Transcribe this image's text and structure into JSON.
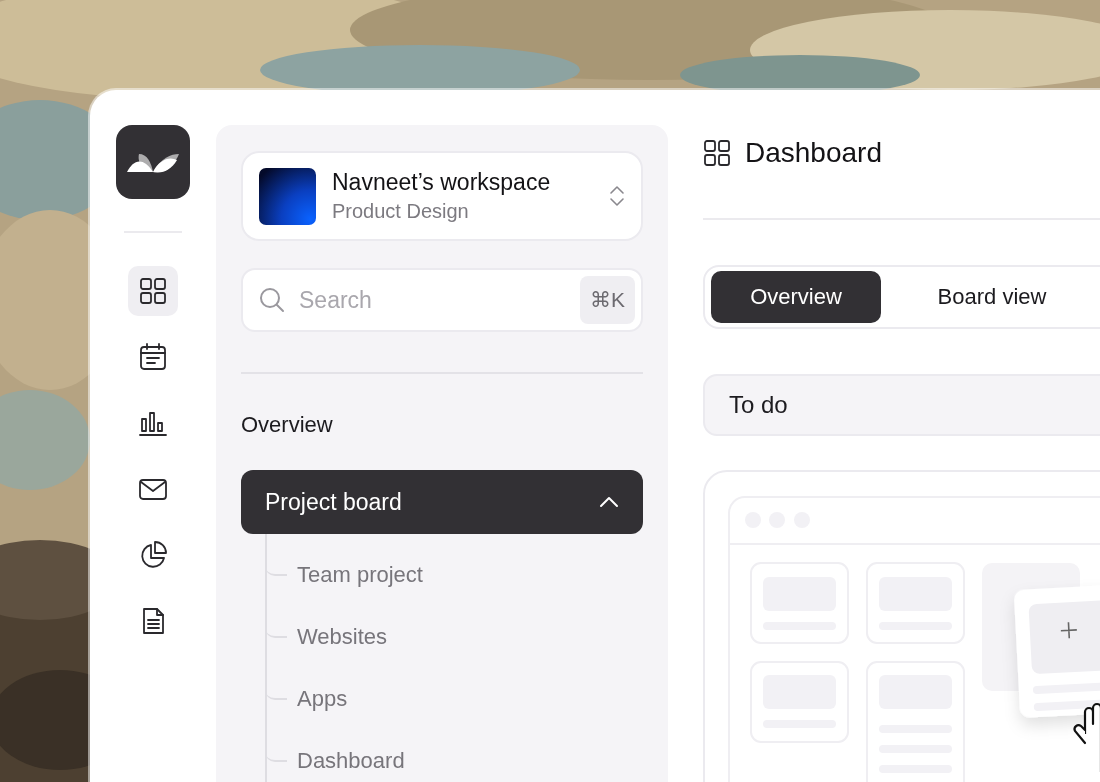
{
  "nav_rail": {
    "items": [
      {
        "kind": "grid",
        "selected": true
      },
      {
        "kind": "calendar",
        "selected": false
      },
      {
        "kind": "chart",
        "selected": false
      },
      {
        "kind": "mail",
        "selected": false
      },
      {
        "kind": "pie",
        "selected": false
      },
      {
        "kind": "document",
        "selected": false
      }
    ]
  },
  "workspace": {
    "name": "Navneet’s workspace",
    "team": "Product Design"
  },
  "search": {
    "placeholder": "Search",
    "shortcut": "⌘K"
  },
  "sidebar": {
    "section": "Overview",
    "group": {
      "label": "Project board",
      "selected": true,
      "expanded": true,
      "children": [
        {
          "label": "Team project"
        },
        {
          "label": "Websites"
        },
        {
          "label": "Apps"
        },
        {
          "label": "Dashboard"
        }
      ]
    }
  },
  "header": {
    "title": "Dashboard"
  },
  "tabs": [
    {
      "label": "Overview",
      "selected": true
    },
    {
      "label": "Board view",
      "selected": false
    }
  ],
  "board": {
    "column_title": "To do"
  }
}
